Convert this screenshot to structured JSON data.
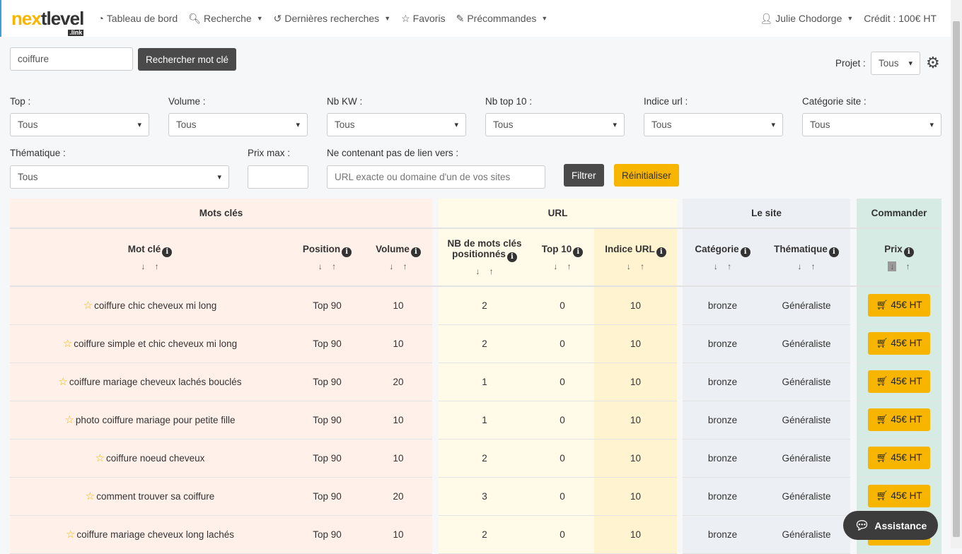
{
  "nav": {
    "logo": "nextlevel",
    "logo_sub": ".link",
    "items": [
      {
        "label": "Tableau de bord",
        "icon": "dashboard-icon",
        "dropdown": false
      },
      {
        "label": "Recherche",
        "icon": "search-icon",
        "dropdown": true
      },
      {
        "label": "Dernières recherches",
        "icon": "history-icon",
        "dropdown": true
      },
      {
        "label": "Favoris",
        "icon": "star-icon",
        "dropdown": false
      },
      {
        "label": "Précommandes",
        "icon": "preorder-icon",
        "dropdown": true
      }
    ],
    "user": "Julie Chodorge",
    "credit": "Crédit : 100€ HT"
  },
  "search": {
    "value": "coiffure",
    "button": "Rechercher mot clé"
  },
  "project": {
    "label": "Projet :",
    "value": "Tous"
  },
  "filters": [
    {
      "label": "Top :",
      "value": "Tous"
    },
    {
      "label": "Volume :",
      "value": "Tous"
    },
    {
      "label": "Nb KW :",
      "value": "Tous"
    },
    {
      "label": "Nb top 10 :",
      "value": "Tous"
    },
    {
      "label": "Indice url :",
      "value": "Tous"
    },
    {
      "label": "Catégorie site :",
      "value": "Tous"
    }
  ],
  "filters2": {
    "thematique_label": "Thématique :",
    "thematique_value": "Tous",
    "prix_label": "Prix max :",
    "prix_value": "",
    "exclude_label": "Ne contenant pas de lien vers :",
    "exclude_placeholder": "URL exacte ou domaine d'un de vos sites",
    "filter_btn": "Filtrer",
    "reset_btn": "Réinitialiser"
  },
  "table": {
    "groups": [
      "Mots clés",
      "URL",
      "Le site",
      "Commander"
    ],
    "columns": [
      "Mot clé",
      "Position",
      "Volume",
      "NB de mots clés positionnés",
      "Top 10",
      "Indice URL",
      "Catégorie",
      "Thématique",
      "Prix"
    ],
    "sort": "↓ ↑",
    "rows": [
      {
        "kw": "coiffure chic cheveux mi long",
        "pos": "Top 90",
        "vol": "10",
        "nb": "2",
        "top10": "0",
        "indice": "10",
        "cat": "bronze",
        "them": "Généraliste",
        "prix": "45€ HT"
      },
      {
        "kw": "coiffure simple et chic cheveux mi long",
        "pos": "Top 90",
        "vol": "10",
        "nb": "2",
        "top10": "0",
        "indice": "10",
        "cat": "bronze",
        "them": "Généraliste",
        "prix": "45€ HT"
      },
      {
        "kw": "coiffure mariage cheveux lachés bouclés",
        "pos": "Top 90",
        "vol": "20",
        "nb": "1",
        "top10": "0",
        "indice": "10",
        "cat": "bronze",
        "them": "Généraliste",
        "prix": "45€ HT"
      },
      {
        "kw": "photo coiffure mariage pour petite fille",
        "pos": "Top 90",
        "vol": "10",
        "nb": "1",
        "top10": "0",
        "indice": "10",
        "cat": "bronze",
        "them": "Généraliste",
        "prix": "45€ HT"
      },
      {
        "kw": "coiffure noeud cheveux",
        "pos": "Top 90",
        "vol": "10",
        "nb": "2",
        "top10": "0",
        "indice": "10",
        "cat": "bronze",
        "them": "Généraliste",
        "prix": "45€ HT"
      },
      {
        "kw": "comment trouver sa coiffure",
        "pos": "Top 90",
        "vol": "20",
        "nb": "3",
        "top10": "0",
        "indice": "10",
        "cat": "bronze",
        "them": "Généraliste",
        "prix": "45€ HT"
      },
      {
        "kw": "coiffure mariage cheveux long lachés",
        "pos": "Top 90",
        "vol": "10",
        "nb": "2",
        "top10": "0",
        "indice": "10",
        "cat": "bronze",
        "them": "Généraliste",
        "prix": "45€ HT"
      }
    ]
  },
  "assistance": "Assistance",
  "colors": {
    "accent": "#f7b500",
    "dark": "#4a4a4a"
  }
}
